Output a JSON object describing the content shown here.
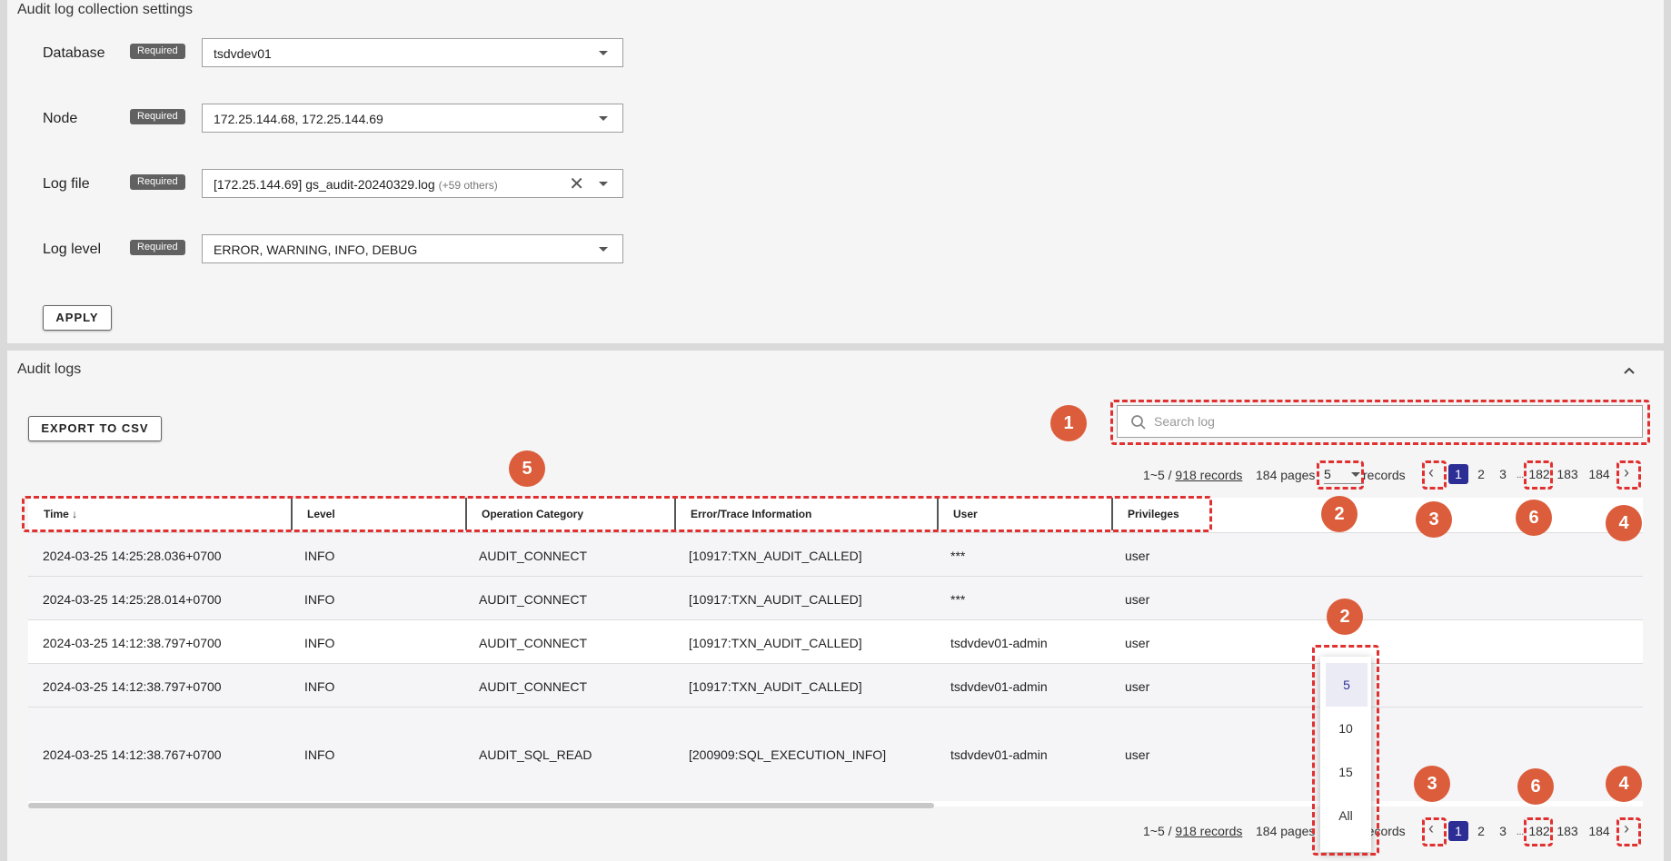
{
  "settings": {
    "title": "Audit log collection settings",
    "required_label": "Required",
    "fields": [
      {
        "label": "Database",
        "value": "tsdvdev01"
      },
      {
        "label": "Node",
        "value": "172.25.144.68, 172.25.144.69"
      },
      {
        "label": "Log file",
        "value": "[172.25.144.69] gs_audit-20240329.log",
        "extra": "(+59 others)"
      },
      {
        "label": "Log level",
        "value": "ERROR, WARNING, INFO, DEBUG"
      }
    ],
    "apply_label": "APPLY"
  },
  "logs": {
    "title": "Audit logs",
    "export_label": "EXPORT TO CSV",
    "search_placeholder": "Search log",
    "pager": {
      "range": "1~5 /",
      "records_link": "918 records",
      "pages": "184 pages",
      "per_page": "5",
      "records_suffix": "records",
      "pages_list": [
        "1",
        "2",
        "3",
        "...",
        "182",
        "183",
        "184"
      ],
      "current_page": "1"
    },
    "columns": [
      "Time",
      "Level",
      "Operation Category",
      "Error/Trace Information",
      "User",
      "Privileges"
    ],
    "rows": [
      [
        "2024-03-25 14:25:28.036+0700",
        "INFO",
        "AUDIT_CONNECT",
        "[10917:TXN_AUDIT_CALLED]",
        "***",
        "user"
      ],
      [
        "2024-03-25 14:25:28.014+0700",
        "INFO",
        "AUDIT_CONNECT",
        "[10917:TXN_AUDIT_CALLED]",
        "***",
        "user"
      ],
      [
        "2024-03-25 14:12:38.797+0700",
        "INFO",
        "AUDIT_CONNECT",
        "[10917:TXN_AUDIT_CALLED]",
        "tsdvdev01-admin",
        "user"
      ],
      [
        "2024-03-25 14:12:38.797+0700",
        "INFO",
        "AUDIT_CONNECT",
        "[10917:TXN_AUDIT_CALLED]",
        "tsdvdev01-admin",
        "user"
      ],
      [
        "2024-03-25 14:12:38.767+0700",
        "INFO",
        "AUDIT_SQL_READ",
        "[200909:SQL_EXECUTION_INFO]",
        "tsdvdev01-admin",
        "user"
      ]
    ],
    "per_page_options": [
      "5",
      "10",
      "15",
      "All"
    ]
  },
  "markers": [
    "1",
    "2",
    "3",
    "4",
    "5",
    "6"
  ],
  "colors": {
    "accent": "#2d2d96",
    "annotation": "#e03030",
    "marker": "#db5d3b"
  }
}
